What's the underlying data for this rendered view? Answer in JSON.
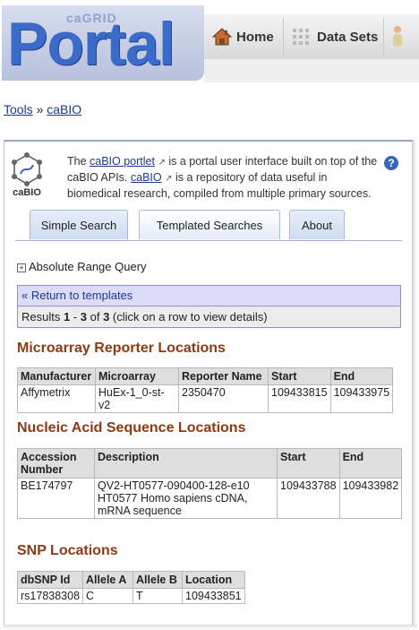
{
  "header": {
    "logo_small": "caGRID",
    "logo_text": "Portal",
    "nav": [
      {
        "label": "Home",
        "icon": "home-icon"
      },
      {
        "label": "Data Sets",
        "icon": "grid-icon"
      },
      {
        "label": "",
        "icon": "person-icon"
      }
    ]
  },
  "breadcrumb": {
    "tools": "Tools",
    "sep": "»",
    "current": "caBIO"
  },
  "intro": {
    "logo_label": "caBIO",
    "text_1": "The ",
    "link_1": "caBIO portlet",
    "text_2": " is a portal user interface built on top of the caBIO APIs. ",
    "link_2": "caBIO",
    "text_3": " is a repository of data useful in biomedical research, compiled from multiple primary sources.",
    "help": "?"
  },
  "tabs": [
    {
      "label": "Simple Search",
      "active": false
    },
    {
      "label": "Templated Searches",
      "active": true
    },
    {
      "label": "About",
      "active": false
    }
  ],
  "absolute_range": {
    "expander": "+",
    "label": "Absolute Range Query"
  },
  "results": {
    "back": "« Return to templates",
    "prefix": "Results ",
    "from": "1",
    "dash": " - ",
    "to": "3",
    "of": " of ",
    "total": "3",
    "hint": " (click on a row to view details)"
  },
  "microarray": {
    "title": "Microarray Reporter Locations",
    "columns": [
      "Manufacturer",
      "Microarray",
      "Reporter Name",
      "Start",
      "End"
    ],
    "rows": [
      [
        "Affymetrix",
        "HuEx-1_0-st-v2",
        "2350470",
        "109433815",
        "109433975"
      ]
    ]
  },
  "nucleic": {
    "title": "Nucleic Acid Sequence Locations",
    "columns": [
      "Accession Number",
      "Description",
      "Start",
      "End"
    ],
    "rows": [
      [
        "BE174797",
        "QV2-HT0577-090400-128-e10 HT0577 Homo sapiens cDNA, mRNA sequence",
        "109433788",
        "109433982"
      ]
    ]
  },
  "snp": {
    "title": "SNP Locations",
    "columns": [
      "dbSNP Id",
      "Allele A",
      "Allele B",
      "Location"
    ],
    "rows": [
      [
        "rs17838308",
        "C",
        "T",
        "109433851"
      ]
    ]
  }
}
